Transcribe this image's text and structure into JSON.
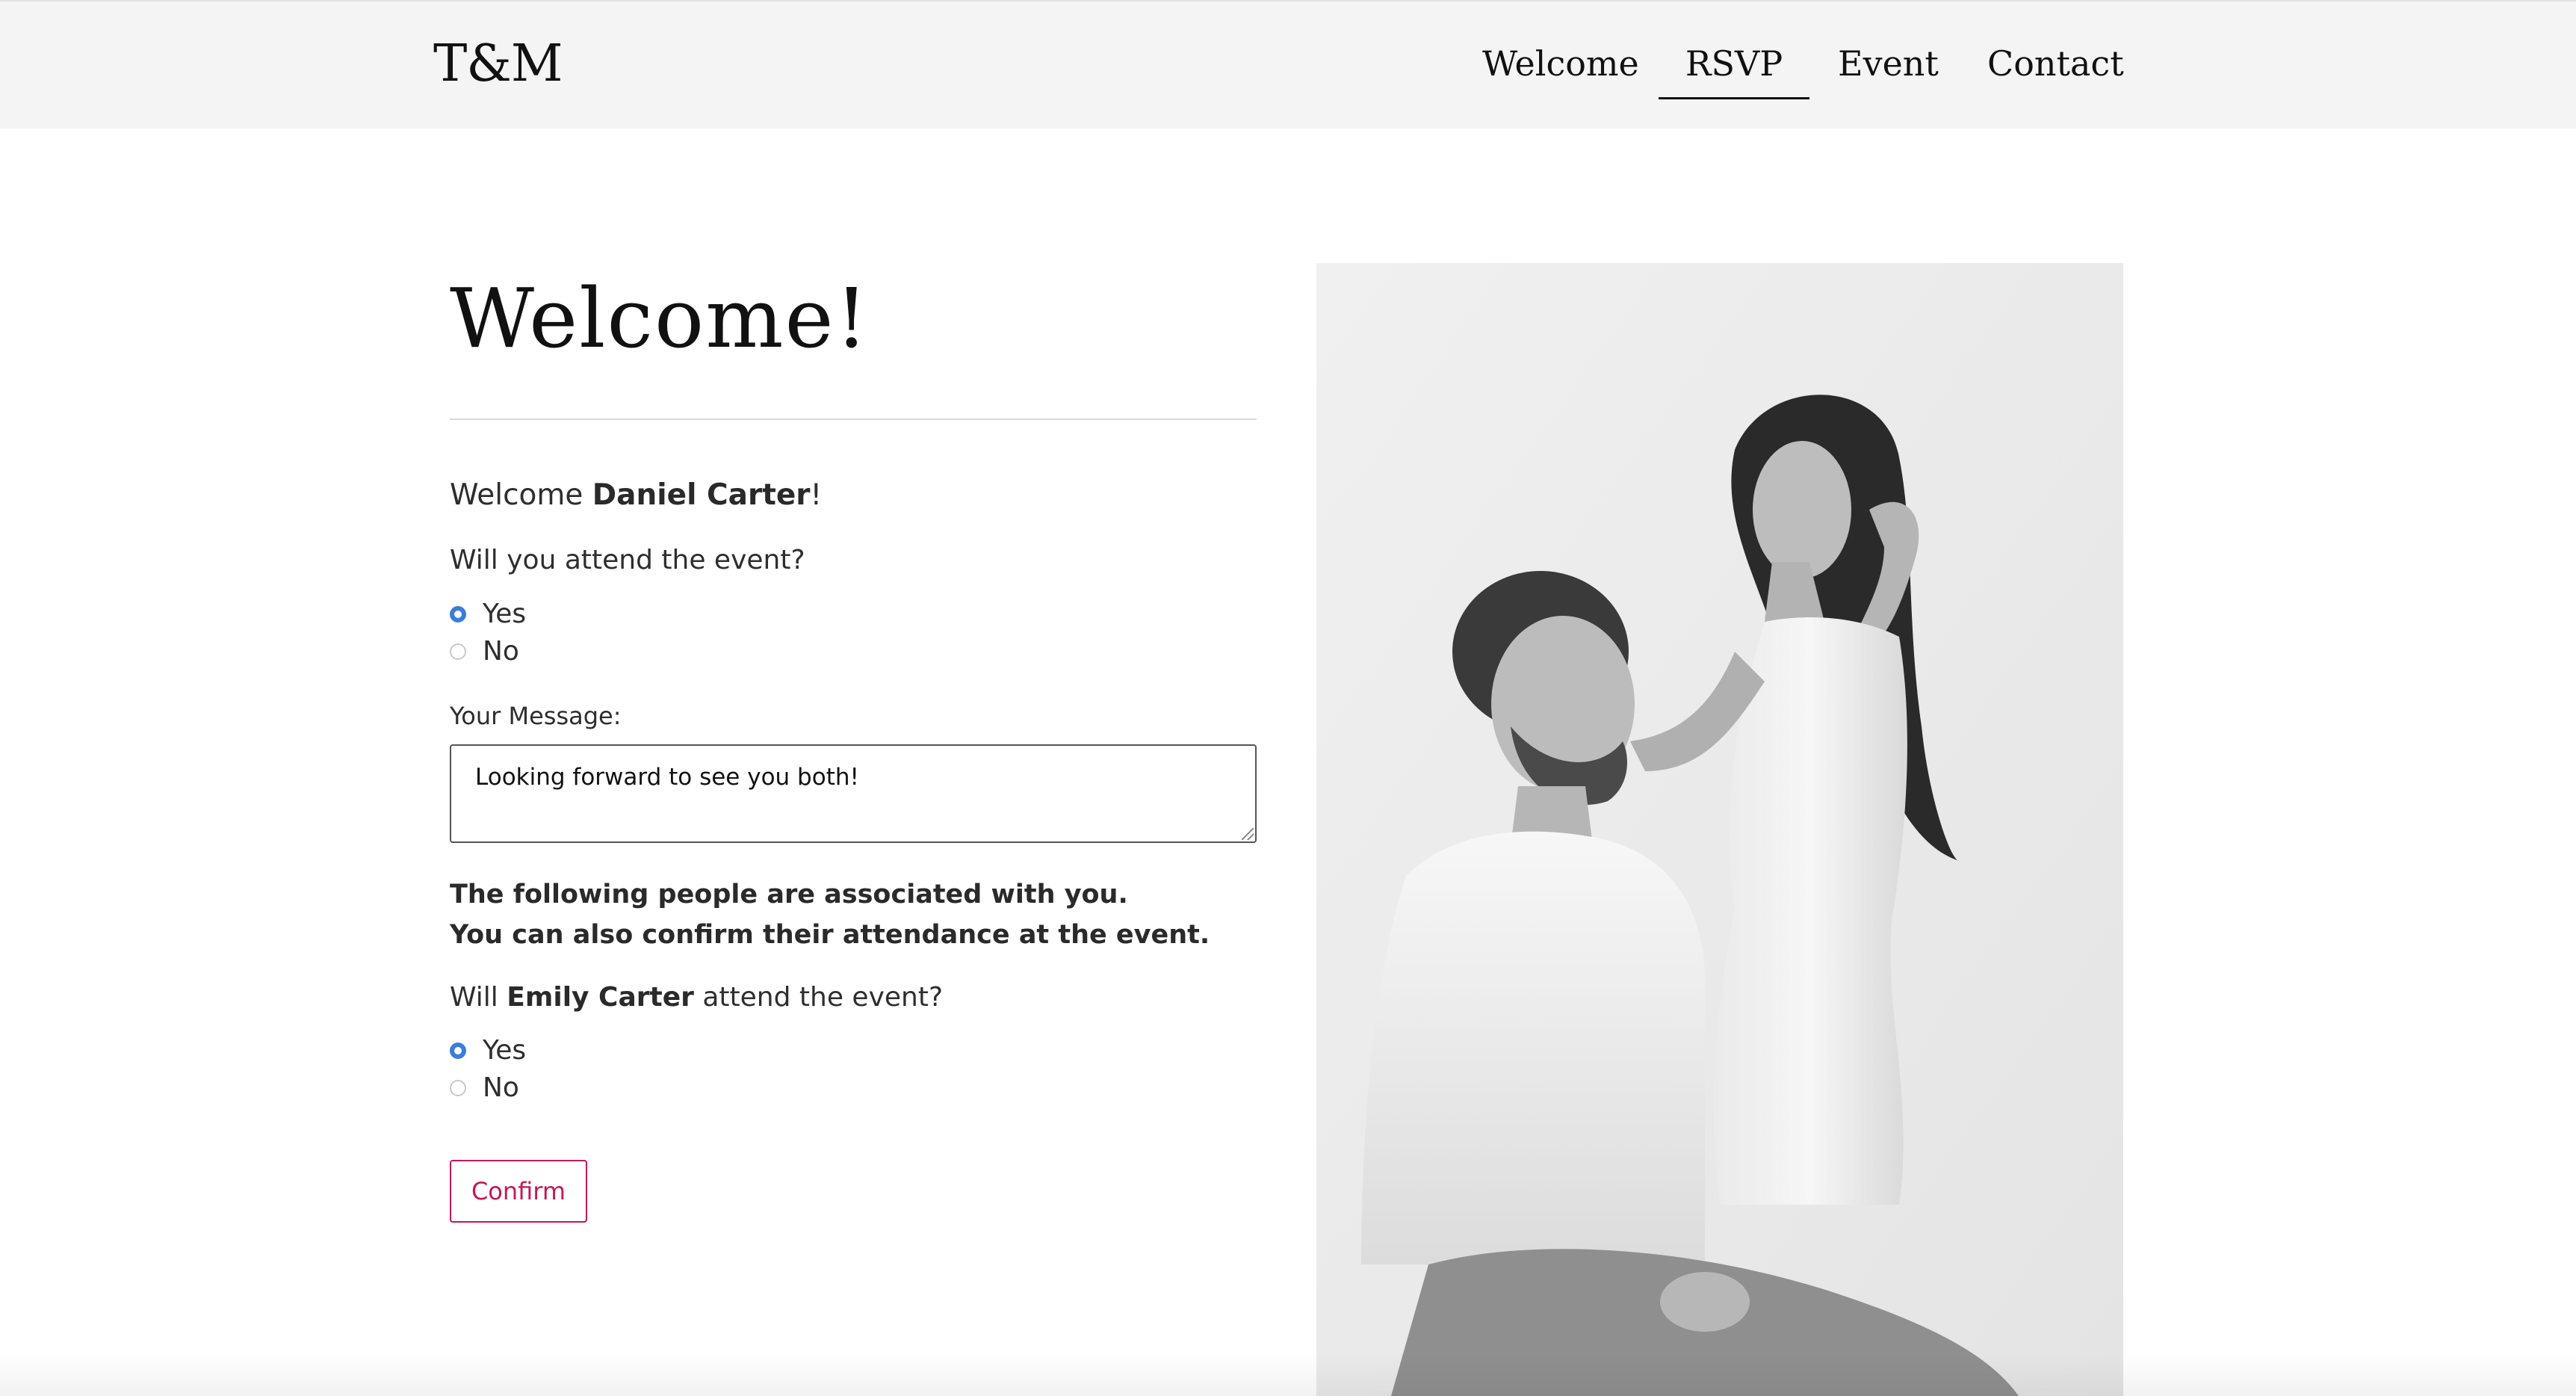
{
  "header": {
    "logo": "T&M",
    "nav": [
      {
        "label": "Welcome"
      },
      {
        "label": "RSVP",
        "active": true
      },
      {
        "label": "Event"
      },
      {
        "label": "Contact"
      }
    ]
  },
  "main": {
    "title": "Welcome!",
    "greeting_prefix": "Welcome ",
    "guest_name": "Daniel Carter",
    "greeting_suffix": "!",
    "attend_question": "Will you attend the event?",
    "attend_options": [
      {
        "label": "Yes",
        "checked": true
      },
      {
        "label": "No",
        "checked": false
      }
    ],
    "message_label": "Your Message:",
    "message_value": "Looking forward to see you both!",
    "associated_line1": "The following people are associated with you.",
    "associated_line2": "You can also confirm their attendance at the event.",
    "companion": {
      "question_prefix": "Will ",
      "name": "Emily Carter",
      "question_suffix": " attend the event?",
      "options": [
        {
          "label": "Yes",
          "checked": true
        },
        {
          "label": "No",
          "checked": false
        }
      ]
    },
    "confirm_label": "Confirm"
  },
  "colors": {
    "accent": "#c2185b",
    "radio_checked": "#3b7ddd",
    "header_bg": "#f4f4f4"
  }
}
